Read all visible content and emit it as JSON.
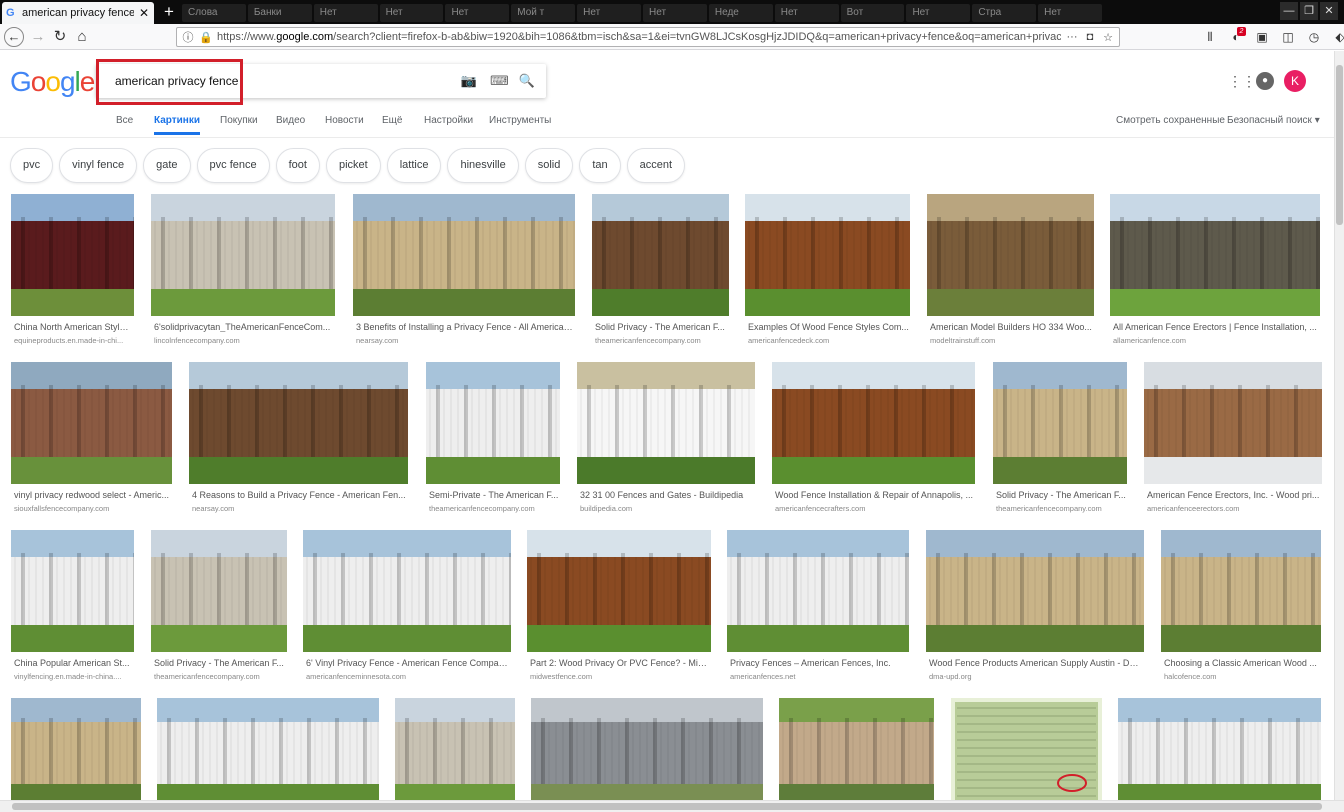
{
  "browser": {
    "active_tab_title": "american privacy fence - Поис",
    "bg_tabs": [
      "Слова",
      "Банки",
      "Нет",
      "Нет",
      "Нет",
      "Мой т",
      "Нет",
      "Нет",
      "Неде",
      "Нет",
      "Вот",
      "Нет",
      "Стра",
      "Нет"
    ],
    "url_prefix": "https://www.",
    "url_domain": "google.com",
    "url_rest": "/search?client=firefox-b-ab&biw=1920&bih=1086&tbm=isch&sa=1&ei=tvnGW8LJCsKosgHjzJDIDQ&q=american+privacy+fence&oq=american+privacy+fence&gs_l=",
    "notification_count": "2"
  },
  "google": {
    "logo_letters": [
      "G",
      "o",
      "o",
      "g",
      "l",
      "e"
    ],
    "query": "american privacy fence",
    "avatar_letter": "K",
    "tabs": [
      "Все",
      "Картинки",
      "Покупки",
      "Видео",
      "Новости",
      "Ещё",
      "Настройки",
      "Инструменты"
    ],
    "active_tab": "Картинки",
    "saved": "Смотреть сохраненные",
    "safesearch": "Безопасный поиск"
  },
  "chips": [
    "pvc",
    "vinyl fence",
    "gate",
    "pvc fence",
    "foot",
    "picket",
    "lattice",
    "hinesville",
    "solid",
    "tan",
    "accent"
  ],
  "results": [
    {
      "title": "China North American Style ...",
      "source": "equineproducts.en.made-in-chi...",
      "style": "maroon"
    },
    {
      "title": "6'solidprivacytan_TheAmericanFenceCom...",
      "source": "lincolnfencecompany.com",
      "style": "tan"
    },
    {
      "title": "3 Benefits of Installing a Privacy Fence - All American ...",
      "source": "nearsay.com",
      "style": "wood-light"
    },
    {
      "title": "Solid Privacy - The American F...",
      "source": "theamericanfencecompany.com",
      "style": "wood-dark"
    },
    {
      "title": "Examples Of Wood Fence Styles Com...",
      "source": "americanfencedeck.com",
      "style": "wood-red"
    },
    {
      "title": "American Model Builders HO 334 Woo...",
      "source": "modeltrainstuff.com",
      "style": "model"
    },
    {
      "title": "All American Fence Erectors | Fence Installation, ...",
      "source": "allamericanfence.com",
      "style": "chain"
    },
    {
      "title": "vinyl privacy redwood select - Americ...",
      "source": "siouxfallsfencecompany.com",
      "style": "redwood"
    },
    {
      "title": "4 Reasons to Build a Privacy Fence - American Fen...",
      "source": "nearsay.com",
      "style": "wood-dark"
    },
    {
      "title": "Semi-Private - The American F...",
      "source": "theamericanfencecompany.com",
      "style": "white"
    },
    {
      "title": "32 31 00 Fences and Gates - Buildipedia",
      "source": "buildipedia.com",
      "style": "picket"
    },
    {
      "title": "Wood Fence Installation & Repair of Annapolis, ...",
      "source": "americanfencecrafters.com",
      "style": "wood-red"
    },
    {
      "title": "Solid Privacy - The American F...",
      "source": "theamericanfencecompany.com",
      "style": "wood-light"
    },
    {
      "title": "American Fence Erectors, Inc. - Wood pri...",
      "source": "americanfenceerectors.com",
      "style": "snow"
    },
    {
      "title": "China Popular American St...",
      "source": "vinylfencing.en.made-in-china....",
      "style": "white"
    },
    {
      "title": "Solid Privacy - The American F...",
      "source": "theamericanfencecompany.com",
      "style": "tan"
    },
    {
      "title": "6' Vinyl Privacy Fence - American Fence Compan...",
      "source": "americanfenceminnesota.com",
      "style": "white"
    },
    {
      "title": "Part 2: Wood Privacy Or PVC Fence? - Mid...",
      "source": "midwestfence.com",
      "style": "wood-red"
    },
    {
      "title": "Privacy Fences – American Fences, Inc.",
      "source": "americanfences.net",
      "style": "white"
    },
    {
      "title": "Wood Fence Products American Supply Austin - DM...",
      "source": "dma-upd.org",
      "style": "wood-light"
    },
    {
      "title": "Choosing a Classic American Wood ...",
      "source": "halcofence.com",
      "style": "wood-light"
    },
    {
      "title": "",
      "source": "",
      "style": "wood-light"
    },
    {
      "title": "",
      "source": "",
      "style": "white"
    },
    {
      "title": "",
      "source": "",
      "style": "tan"
    },
    {
      "title": "",
      "source": "",
      "style": "gray"
    },
    {
      "title": "",
      "source": "",
      "style": "stone"
    },
    {
      "title": "",
      "source": "",
      "style": "table"
    },
    {
      "title": "",
      "source": "",
      "style": "white"
    }
  ],
  "colors": {
    "accent": "#1a73e8",
    "highlight": "#d21f2a",
    "avatar": "#e91e63"
  }
}
